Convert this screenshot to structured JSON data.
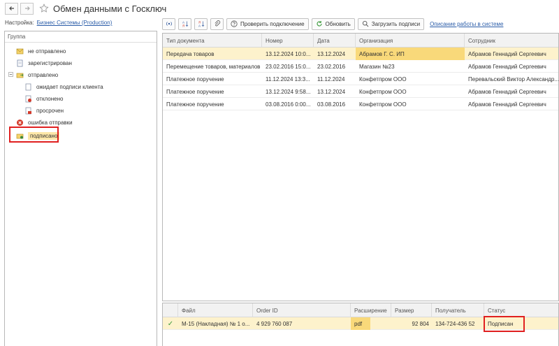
{
  "header": {
    "title": "Обмен данными с Госключ"
  },
  "settings": {
    "label": "Настройка:",
    "value": "Бизнес Системы (Production)"
  },
  "group_panel": {
    "header": "Группа",
    "items": [
      {
        "label": "не отправлено"
      },
      {
        "label": "зарегистрирован"
      },
      {
        "label": "отправлено"
      },
      {
        "label": "ожидает подписи клиента"
      },
      {
        "label": "отклонено"
      },
      {
        "label": "просрочен"
      },
      {
        "label": "ошибка отправки"
      },
      {
        "label": "подписано"
      }
    ]
  },
  "toolbar": {
    "check_connection": "Проверить подключение",
    "refresh": "Обновить",
    "load_signatures": "Загрузить подписи",
    "help_link": "Описание работы в системе"
  },
  "documents": {
    "columns": [
      "Тип документа",
      "Номер",
      "Дата",
      "Организация",
      "Сотрудник"
    ],
    "rows": [
      [
        "Передача товаров",
        "13.12.2024 10:0...",
        "13.12.2024",
        "Абрамов Г. С. ИП",
        "Абрамов Геннадий Сергеевич"
      ],
      [
        "Перемещение товаров, материалов",
        "23.02.2016 15:0...",
        "23.02.2016",
        "Магазин №23",
        "Абрамов Геннадий Сергеевич"
      ],
      [
        "Платежное поручение",
        "11.12.2024 13:3...",
        "11.12.2024",
        "Конфетпром ООО",
        "Перевальский Виктор Александр..."
      ],
      [
        "Платежное поручение",
        "13.12.2024 9:58...",
        "13.12.2024",
        "Конфетпром ООО",
        "Абрамов Геннадий Сергеевич"
      ],
      [
        "Платежное поручение",
        "03.08.2016 0:00...",
        "03.08.2016",
        "Конфетпром ООО",
        "Абрамов Геннадий Сергеевич"
      ]
    ]
  },
  "files": {
    "columns": [
      "Файл",
      "Order ID",
      "Расширение",
      "Размер",
      "Получатель",
      "Статус"
    ],
    "rows": [
      [
        "М-15 (Накладная) № 1 о...",
        "4 929 760 087",
        "pdf",
        "92 804",
        "134-724-436 52",
        "Подписан"
      ]
    ]
  },
  "colors": {
    "selected_row": "#fdf2cc",
    "selected_cell": "#f9d97a",
    "highlight_border": "#e02020",
    "link": "#2a5ca8"
  }
}
